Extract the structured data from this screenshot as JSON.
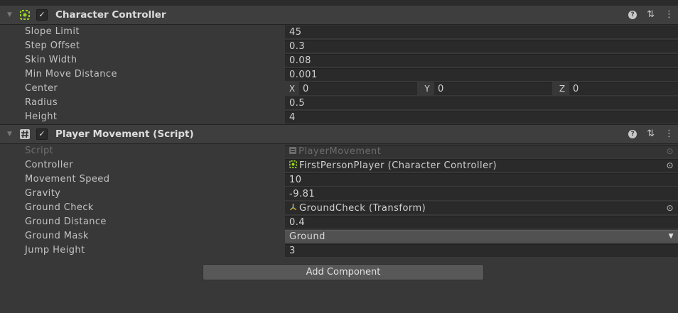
{
  "character_controller": {
    "title": "Character Controller",
    "fields": [
      {
        "label": "Slope Limit",
        "value": "45"
      },
      {
        "label": "Step Offset",
        "value": "0.3"
      },
      {
        "label": "Skin Width",
        "value": "0.08"
      },
      {
        "label": "Min Move Distance",
        "value": "0.001"
      }
    ],
    "center": {
      "label": "Center",
      "x_label": "X",
      "x": "0",
      "y_label": "Y",
      "y": "0",
      "z_label": "Z",
      "z": "0"
    },
    "radius": {
      "label": "Radius",
      "value": "0.5"
    },
    "height": {
      "label": "Height",
      "value": "4"
    }
  },
  "player_movement": {
    "title": "Player Movement (Script)",
    "script": {
      "label": "Script",
      "value": "PlayerMovement"
    },
    "controller": {
      "label": "Controller",
      "value": "FirstPersonPlayer (Character Controller)"
    },
    "movement_speed": {
      "label": "Movement Speed",
      "value": "10"
    },
    "gravity": {
      "label": "Gravity",
      "value": "-9.81"
    },
    "ground_check": {
      "label": "Ground Check",
      "value": "GroundCheck (Transform)"
    },
    "ground_distance": {
      "label": "Ground Distance",
      "value": "0.4"
    },
    "ground_mask": {
      "label": "Ground Mask",
      "value": "Ground"
    },
    "jump_height": {
      "label": "Jump Height",
      "value": "3"
    }
  },
  "add_component": {
    "label": "Add Component"
  },
  "colors": {
    "background": "#383838",
    "header": "#3e3e3e",
    "field": "#2a2a2a",
    "controller_icon": "#9bd81c"
  }
}
